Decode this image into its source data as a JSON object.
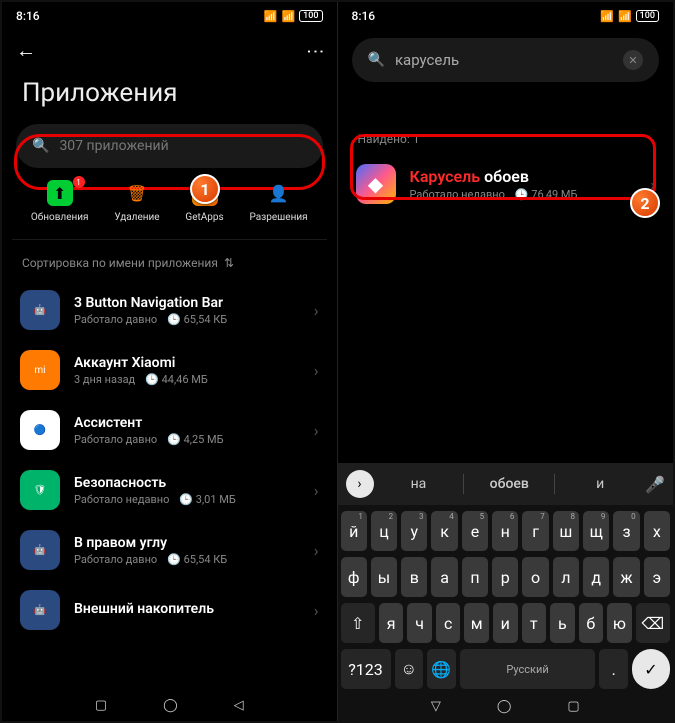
{
  "status": {
    "time": "8:16",
    "battery": "100"
  },
  "left": {
    "title": "Приложения",
    "search_placeholder": "307 приложений",
    "actions": {
      "update": "Обновления",
      "update_badge": "1",
      "delete": "Удаление",
      "getapps": "GetApps",
      "perms": "Разрешения"
    },
    "sort_label": "Сортировка по имени приложения",
    "apps": [
      {
        "name": "3 Button Navigation Bar",
        "sub": "Работало давно",
        "size": "65,54 КБ",
        "icon_bg": "#2b4a80",
        "icon_glyph": "🤖"
      },
      {
        "name": "Аккаунт Xiaomi",
        "sub": "3 дня назад",
        "size": "44,46 МБ",
        "icon_bg": "#ff7a00",
        "icon_glyph": "mi"
      },
      {
        "name": "Ассистент",
        "sub": "Работало давно",
        "size": "4,25 МБ",
        "icon_bg": "#fff",
        "icon_glyph": "🔵"
      },
      {
        "name": "Безопасность",
        "sub": "Работало недавно",
        "size": "3,01 МБ",
        "icon_bg": "#00b36b",
        "icon_glyph": "🛡"
      },
      {
        "name": "В правом углу",
        "sub": "Работало давно",
        "size": "65,54 КБ",
        "icon_bg": "#2b4a80",
        "icon_glyph": "🤖"
      },
      {
        "name": "Внешний накопитель",
        "sub": "",
        "size": "",
        "icon_bg": "#2b4a80",
        "icon_glyph": "🤖"
      }
    ]
  },
  "right": {
    "query": "карусель",
    "found_label": "Найдено: 1",
    "result": {
      "highlight": "Карусель",
      "rest": " обоев",
      "sub": "Работало недавно",
      "size": "76,49 МБ"
    },
    "suggestions": [
      "на",
      "обоев",
      "и"
    ],
    "kbd": {
      "row1": [
        [
          "й",
          "1"
        ],
        [
          "ц",
          "2"
        ],
        [
          "у",
          "3"
        ],
        [
          "к",
          "4"
        ],
        [
          "е",
          "5"
        ],
        [
          "н",
          "6"
        ],
        [
          "г",
          "7"
        ],
        [
          "ш",
          "8"
        ],
        [
          "щ",
          "9"
        ],
        [
          "з",
          "0"
        ],
        [
          "х",
          ""
        ]
      ],
      "row2": [
        "ф",
        "ы",
        "в",
        "а",
        "п",
        "р",
        "о",
        "л",
        "д",
        "ж",
        "э"
      ],
      "row3": [
        "я",
        "ч",
        "с",
        "м",
        "и",
        "т",
        "ь",
        "б",
        "ю"
      ],
      "lang": "Русский",
      "num": "?123"
    }
  },
  "annotations": {
    "step1": "1",
    "step2": "2"
  }
}
